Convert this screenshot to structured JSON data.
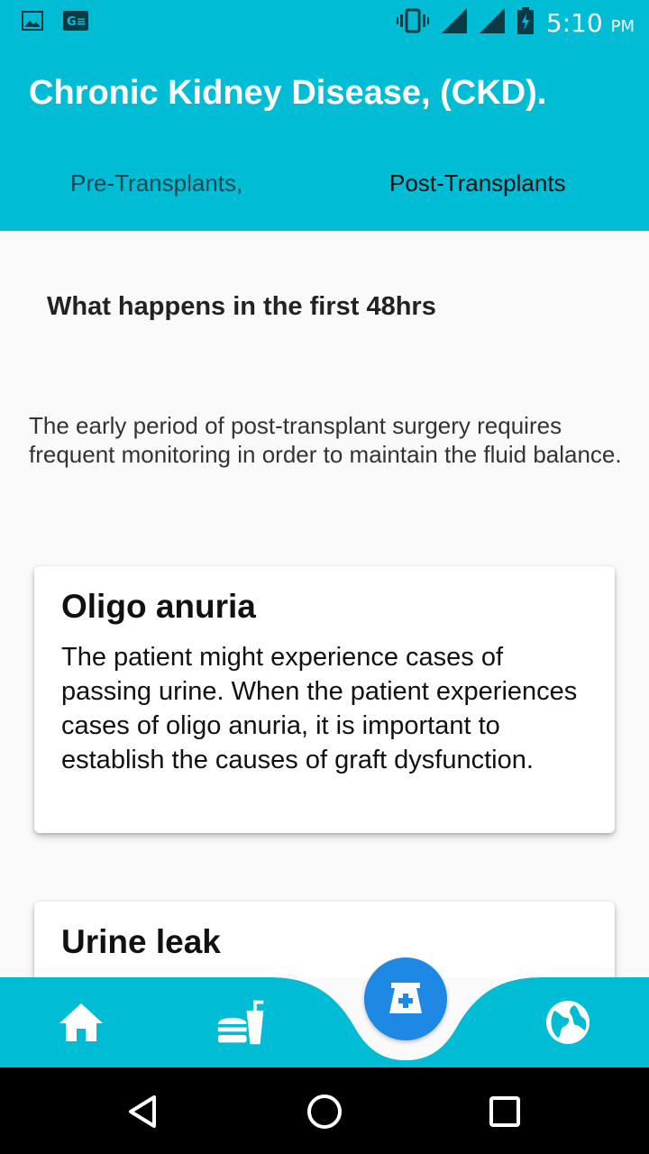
{
  "status_bar": {
    "time": "5:10",
    "ampm": "PM",
    "icons": [
      "image-icon",
      "ge-icon",
      "vibrate-icon",
      "signal-icon",
      "signal-icon",
      "battery-charging-icon"
    ]
  },
  "app_bar": {
    "title": "Chronic Kidney Disease, (CKD).",
    "tabs": [
      {
        "label": "Pre-Transplants,"
      },
      {
        "label": "Post-Transplants"
      }
    ]
  },
  "main": {
    "heading": "What happens in the first 48hrs",
    "intro": "The early period of post-transplant surgery requires frequent monitoring in order to maintain the fluid balance.",
    "cards": [
      {
        "title": "Oligo anuria",
        "body": "The patient might experience cases of passing urine. When the patient experiences cases of oligo anuria, it is important to establish the causes of graft dysfunction."
      },
      {
        "title": "Urine leak"
      }
    ]
  },
  "bottom_nav": {
    "items": [
      "home-icon",
      "fastfood-icon",
      "pharmacy-icon",
      "globe-icon"
    ]
  },
  "colors": {
    "primary": "#00bcd4",
    "fab": "#1e88e5",
    "background": "#fafafa"
  }
}
